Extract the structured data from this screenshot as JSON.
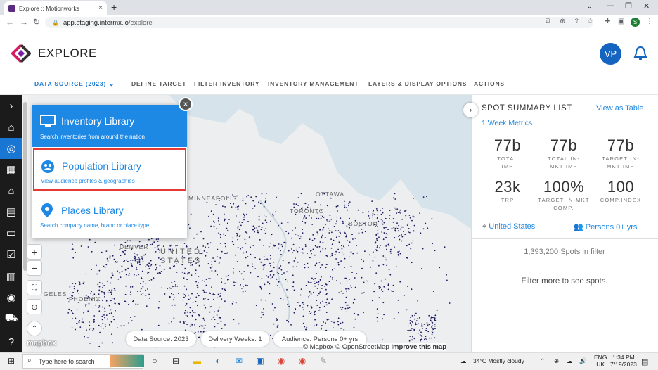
{
  "browser": {
    "tab_title": "Explore :: Motionworks",
    "tab_close": "×",
    "new_tab": "+",
    "url_host": "app.staging.intermx.io",
    "url_path": "/explore",
    "profile_initial": "S"
  },
  "header": {
    "title": "EXPLORE",
    "avatar": "VP"
  },
  "nav": {
    "items": [
      {
        "label": "DATA SOURCE (2023)",
        "active": true
      },
      {
        "label": "DEFINE TARGET"
      },
      {
        "label": "FILTER INVENTORY"
      },
      {
        "label": "INVENTORY MANAGEMENT"
      },
      {
        "label": "LAYERS & DISPLAY OPTIONS"
      },
      {
        "label": "ACTIONS"
      }
    ]
  },
  "library": {
    "items": [
      {
        "title": "Inventory Library",
        "subtitle": "Search inventories from around the nation",
        "icon": "monitor-icon"
      },
      {
        "title": "Population Library",
        "subtitle": "View audience profiles & geographies",
        "icon": "people-icon"
      },
      {
        "title": "Places Library",
        "subtitle": "Search company name, brand or place type",
        "icon": "pin-icon"
      }
    ],
    "close": "×"
  },
  "map": {
    "labels": [
      "OTTAWA",
      "MINNEAPOLIS",
      "TORONTO",
      "BOSTON",
      "DENVER",
      "UNITED",
      "STATES",
      "PHOENIX",
      "GELES"
    ],
    "zoom_in": "+",
    "zoom_out": "−",
    "mapbox": "mapbox",
    "attribution_text": "© Mapbox © OpenStreetMap",
    "improve_link": "Improve this map",
    "pills": [
      "Data Source: 2023",
      "Delivery Weeks: 1",
      "Audience: Persons 0+ yrs"
    ]
  },
  "summary": {
    "title": "SPOT SUMMARY LIST",
    "view_table": "View as Table",
    "week_metrics": "1 Week Metrics",
    "metrics": [
      {
        "value": "77b",
        "label": "TOTAL IMP"
      },
      {
        "value": "77b",
        "label": "TOTAL IN-MKT IMP"
      },
      {
        "value": "77b",
        "label": "TARGET IN-MKT IMP"
      },
      {
        "value": "23k",
        "label": "TRP"
      },
      {
        "value": "100%",
        "label": "TARGET IN-MKT COMP."
      },
      {
        "value": "100",
        "label": "COMP.INDEX"
      }
    ],
    "location": "United States",
    "audience": "Persons 0+ yrs",
    "spots_in_filter": "1,393,200 Spots in filter",
    "filter_more": "Filter more to see spots."
  },
  "taskbar": {
    "search_placeholder": "Type here to search",
    "weather": "34°C  Mostly cloudy",
    "lang1": "ENG",
    "lang2": "UK",
    "time": "1:34 PM",
    "date": "7/19/2023"
  },
  "colors": {
    "accent": "#1e88e5",
    "rail": "#1b1b1b",
    "highlight": "#e53935",
    "map_dots": "#1a1a5e"
  }
}
